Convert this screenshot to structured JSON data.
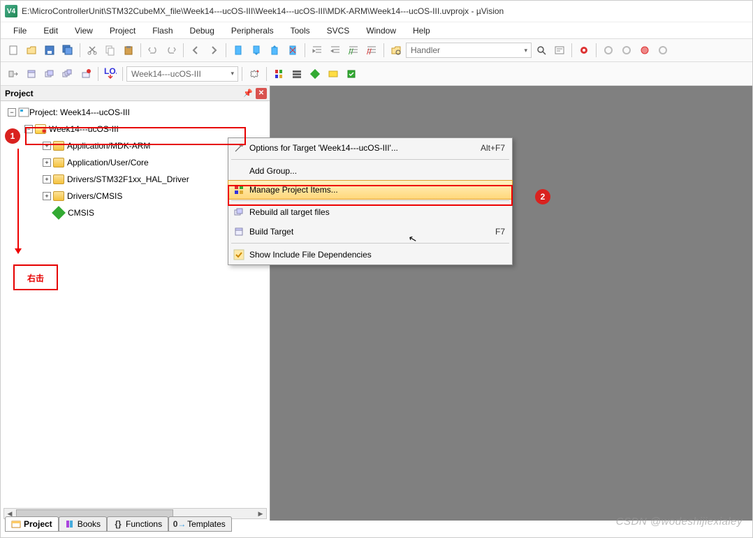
{
  "title": "E:\\MicroControllerUnit\\STM32CubeMX_file\\Week14---ucOS-III\\Week14---ucOS-III\\MDK-ARM\\Week14---ucOS-III.uvprojx - µVision",
  "menu": [
    "File",
    "Edit",
    "View",
    "Project",
    "Flash",
    "Debug",
    "Peripherals",
    "Tools",
    "SVCS",
    "Window",
    "Help"
  ],
  "toolbar_combo": "Handler",
  "target_combo": "Week14---ucOS-III",
  "panel_title": "Project",
  "tree": {
    "root": "Project: Week14---ucOS-III",
    "target": "Week14---ucOS-III",
    "folders": [
      "Application/MDK-ARM",
      "Application/User/Core",
      "Drivers/STM32F1xx_HAL_Driver",
      "Drivers/CMSIS"
    ],
    "cmsis": "CMSIS"
  },
  "annotation": {
    "badge1": "1",
    "badge2": "2",
    "rightclick": "右击"
  },
  "context_menu": {
    "options": "Options for Target 'Week14---ucOS-III'...",
    "options_sc": "Alt+F7",
    "addgroup": "Add Group...",
    "manage": "Manage Project Items...",
    "rebuild": "Rebuild all target files",
    "build": "Build Target",
    "build_sc": "F7",
    "showinc": "Show Include File Dependencies"
  },
  "bottom_tabs": {
    "project": "Project",
    "books": "Books",
    "functions": "Functions",
    "templates": "Templates"
  },
  "watermark": "CSDN @wodeshijiexialey"
}
